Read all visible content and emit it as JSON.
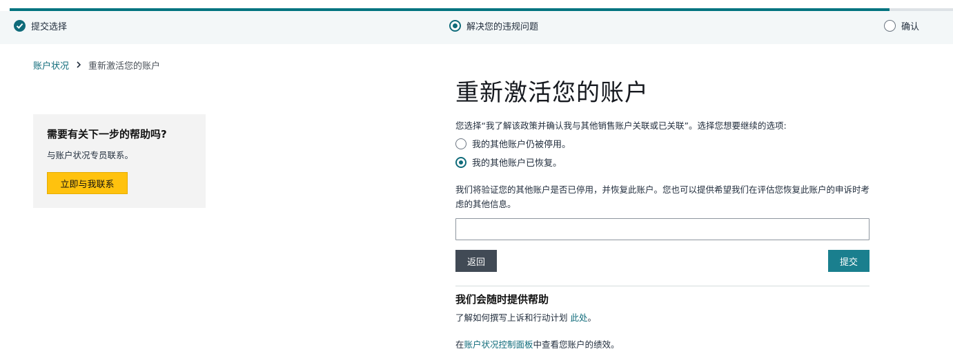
{
  "progress": {
    "fraction": 0.933
  },
  "steps": [
    {
      "label": "提交选择",
      "state": "done"
    },
    {
      "label": "解决您的违规问题",
      "state": "current"
    },
    {
      "label": "确认",
      "state": "pending"
    }
  ],
  "breadcrumb": {
    "parent": "账户状况",
    "separator": ">",
    "current": "重新激活您的账户"
  },
  "help_card": {
    "title": "需要有关下一步的帮助吗?",
    "text": "与账户状况专员联系。",
    "button": "立即与我联系"
  },
  "main": {
    "title": "重新激活您的账户",
    "intro": "您选择“我了解该政策并确认我与其他销售账户关联或已关联”。选择您想要继续的选项:",
    "options": [
      {
        "label": "我的其他账户仍被停用。",
        "checked": false
      },
      {
        "label": "我的其他账户已恢复。",
        "checked": true
      }
    ],
    "description": "我们将验证您的其他账户是否已停用，并恢复此账户。您也可以提供希望我们在评估您恢复此账户的申诉时考虑的其他信息。",
    "input_value": "",
    "back_button": "返回",
    "submit_button": "提交",
    "help_heading": "我们会随时提供帮助",
    "help_line1_prefix": "了解如何撰写上诉和行动计划 ",
    "help_line1_link": "此处",
    "help_line1_suffix": "。",
    "help_line2_prefix": "在",
    "help_line2_link": "账户状况控制面板",
    "help_line2_suffix": "中查看您账户的绩效。"
  },
  "colors": {
    "accent": "#0f6b7a",
    "cta_yellow": "#ffc20e",
    "dark_button": "#414a55",
    "submit_button": "#1a7f8e"
  }
}
